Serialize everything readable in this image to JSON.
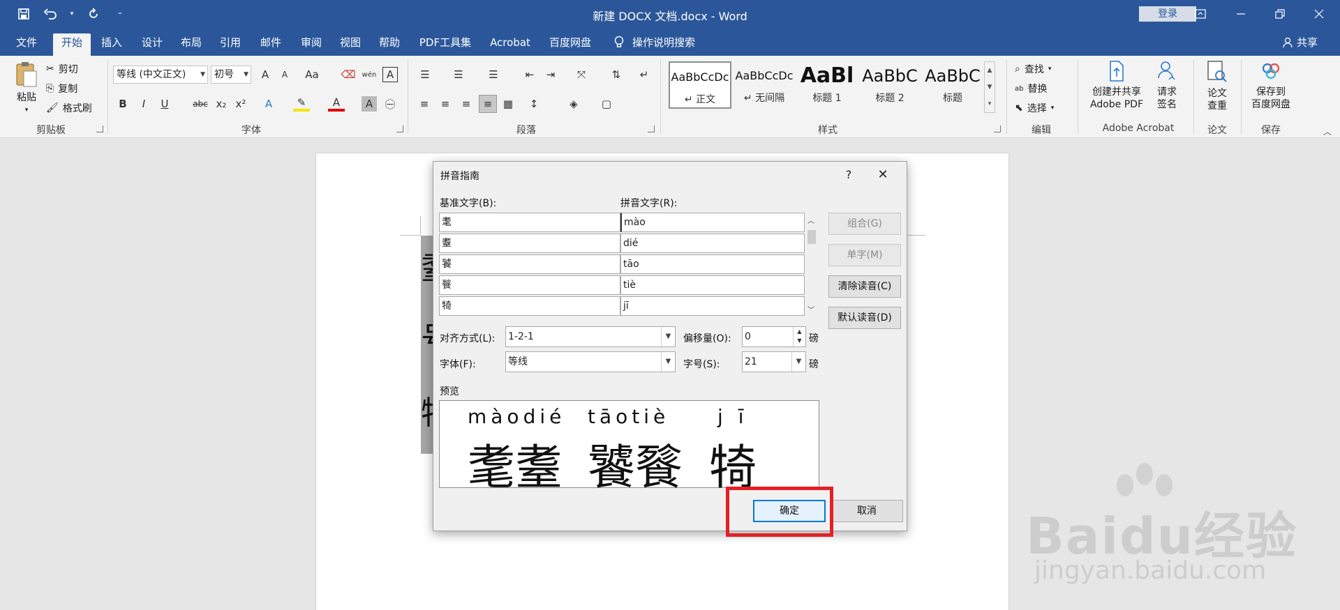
{
  "titlebar": {
    "doc_title": "新建 DOCX 文档.docx - Word",
    "login": "登录"
  },
  "tabs": [
    "文件",
    "开始",
    "插入",
    "设计",
    "布局",
    "引用",
    "邮件",
    "审阅",
    "视图",
    "帮助",
    "PDF工具集",
    "Acrobat",
    "百度网盘"
  ],
  "active_tab": "开始",
  "help_search": "操作说明搜索",
  "share": "共享",
  "clipboard": {
    "paste": "粘贴",
    "cut": "剪切",
    "copy": "复制",
    "format_painter": "格式刷",
    "label": "剪贴板"
  },
  "font": {
    "font_name": "等线 (中文正文)",
    "font_size": "初号",
    "label": "字体",
    "grow": "A",
    "shrink": "A",
    "case": "Aa",
    "bold": "B",
    "italic": "I",
    "underline": "U",
    "strike": "abc",
    "sub": "x₂",
    "sup": "x²",
    "phonetic": "wén"
  },
  "paragraph": {
    "label": "段落"
  },
  "styles": {
    "label": "样式",
    "items": [
      {
        "sample": "AaBbCcDc",
        "name": "↵ 正文"
      },
      {
        "sample": "AaBbCcDc",
        "name": "↵ 无间隔"
      },
      {
        "sample": "AaBl",
        "name": "标题 1"
      },
      {
        "sample": "AaBbC",
        "name": "标题 2"
      },
      {
        "sample": "AaBbC",
        "name": "标题"
      }
    ]
  },
  "editing": {
    "label": "编辑",
    "find": "查找",
    "replace": "替换",
    "select": "选择"
  },
  "acrobat": {
    "label": "Adobe Acrobat",
    "create_share_1": "创建并共享",
    "create_share_2": "Adobe PDF",
    "request_sign_1": "请求",
    "request_sign_2": "签名"
  },
  "paper": {
    "label": "论文",
    "btn_1": "论文",
    "btn_2": "查重"
  },
  "save": {
    "label": "保存",
    "btn_1": "保存到",
    "btn_2": "百度网盘"
  },
  "dialog": {
    "title": "拼音指南",
    "help": "?",
    "close": "✕",
    "base_text_label": "基准文字(B):",
    "ruby_text_label": "拼音文字(R):",
    "rows": [
      {
        "base": "耄",
        "ruby": "mào"
      },
      {
        "base": "耋",
        "ruby": "dié"
      },
      {
        "base": "饕",
        "ruby": "tāo"
      },
      {
        "base": "餮",
        "ruby": "tiè"
      },
      {
        "base": "犄",
        "ruby": "jī"
      }
    ],
    "btn_group": "组合(G)",
    "btn_mono": "单字(M)",
    "btn_clear": "清除读音(C)",
    "btn_default": "默认读音(D)",
    "align_label": "对齐方式(L):",
    "align_value": "1-2-1",
    "offset_label": "偏移量(O):",
    "offset_value": "0",
    "offset_unit": "磅",
    "font_label": "字体(F):",
    "font_value": "等线",
    "size_label": "字号(S):",
    "size_value": "21",
    "size_unit": "磅",
    "preview_label": "预览",
    "preview_ruby_1": "màodié",
    "preview_base_1": "耄耋",
    "preview_ruby_2": "tāotiè",
    "preview_base_2": "饕餮",
    "preview_ruby_3": "jī",
    "preview_base_3": "犄",
    "ok": "确定",
    "cancel": "取消"
  },
  "document": {
    "chars": [
      "耋",
      "号",
      "犄"
    ]
  },
  "watermark": {
    "main": "Baidu经验",
    "sub": "jingyan.baidu.com"
  },
  "colors": {
    "accent": "#2b579a",
    "highlight": "#e32026",
    "primary_button_border": "#0078d7"
  }
}
